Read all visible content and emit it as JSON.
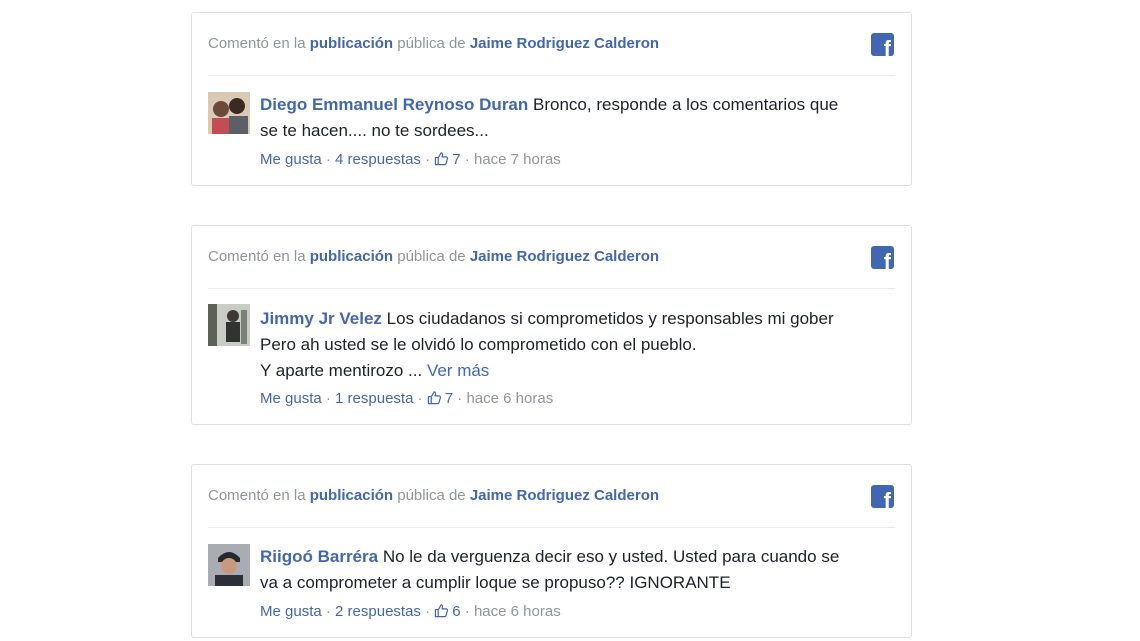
{
  "comments": [
    {
      "header": {
        "prefix": "Comentó en la",
        "post_link": "publicación",
        "middle": "pública de",
        "page_link": "Jaime Rodriguez Calderon"
      },
      "author": "Diego Emmanuel Reynoso Duran",
      "text_lines": [
        "Bronco, responde a los comentarios que",
        "se te hacen.... no te sordees..."
      ],
      "see_more": "",
      "like_label": "Me gusta",
      "replies_label": "4 respuestas",
      "like_count": "7",
      "time": "hace 7 horas"
    },
    {
      "header": {
        "prefix": "Comentó en la",
        "post_link": "publicación",
        "middle": "pública de",
        "page_link": "Jaime Rodriguez Calderon"
      },
      "author": "Jimmy Jr Velez",
      "text_lines": [
        "Los ciudadanos si comprometidos y responsables mi gober",
        "Pero ah usted se le olvidó lo comprometido con el pueblo.",
        "Y aparte mentirozo ..."
      ],
      "see_more": "Ver más",
      "like_label": "Me gusta",
      "replies_label": "1 respuesta",
      "like_count": "7",
      "time": "hace 6 horas"
    },
    {
      "header": {
        "prefix": "Comentó en la",
        "post_link": "publicación",
        "middle": "pública de",
        "page_link": "Jaime Rodriguez Calderon"
      },
      "author": "Riigoó Barréra",
      "text_lines": [
        "No le da verguenza decir eso y usted. Usted para cuando se",
        "va a comprometer a cumplir loque se propuso?? IGNORANTE"
      ],
      "see_more": "",
      "like_label": "Me gusta",
      "replies_label": "2 respuestas",
      "like_count": "6",
      "time": "hace 6 horas"
    }
  ],
  "colors": {
    "link": "#4267b2",
    "meta": "#90949c",
    "text": "#1d2129",
    "border": "#dddfe2"
  },
  "icons": {
    "brand": "facebook-icon",
    "like": "thumbs-up-icon"
  }
}
